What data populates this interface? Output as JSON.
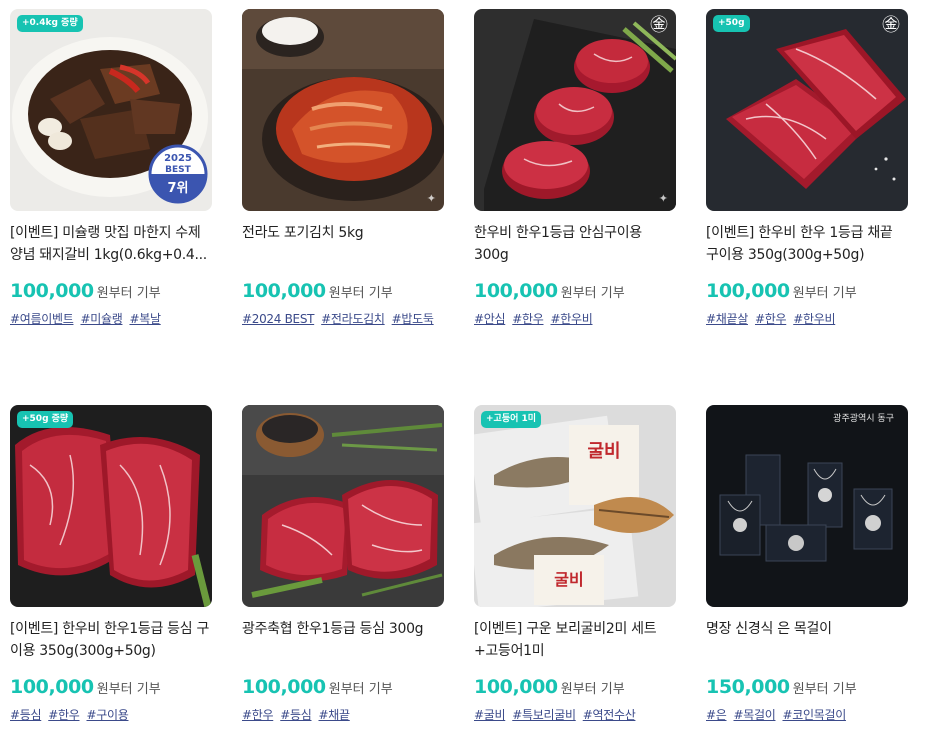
{
  "accent_color": "#17c3b2",
  "tag_color": "#3b4a8a",
  "products": [
    {
      "badge": "+0.4kg 증량",
      "image_overlay": [
        "2025",
        "BEST",
        "7위"
      ],
      "title": "[이벤트] 미슐랭 맛집 마한지 수제 양념 돼지갈비 1kg(0.6kg+0.4...",
      "price": "100,000",
      "price_suffix": "원부터 기부",
      "tags": [
        "#여름이벤트",
        "#미슐랭",
        "#복날"
      ]
    },
    {
      "badge": "",
      "title": "전라도 포기김치 5kg",
      "price": "100,000",
      "price_suffix": "원부터 기부",
      "tags": [
        "#2024 BEST",
        "#전라도김치",
        "#밥도둑"
      ]
    },
    {
      "badge": "",
      "title": "한우비 한우1등급 안심구이용 300g",
      "price": "100,000",
      "price_suffix": "원부터 기부",
      "tags": [
        "#안심",
        "#한우",
        "#한우비"
      ]
    },
    {
      "badge": "+50g",
      "title": "[이벤트] 한우비 한우 1등급 채끝 구이용 350g(300g+50g)",
      "price": "100,000",
      "price_suffix": "원부터 기부",
      "tags": [
        "#채끝살",
        "#한우",
        "#한우비"
      ]
    },
    {
      "badge": "+50g 증량",
      "title": "[이벤트] 한우비 한우1등급 등심 구이용 350g(300g+50g)",
      "price": "100,000",
      "price_suffix": "원부터 기부",
      "tags": [
        "#등심",
        "#한우",
        "#구이용"
      ]
    },
    {
      "badge": "",
      "title": "광주축협 한우1등급 등심 300g",
      "price": "100,000",
      "price_suffix": "원부터 기부",
      "tags": [
        "#한우",
        "#등심",
        "#채끝"
      ]
    },
    {
      "badge": "+고등어 1미",
      "title": "[이벤트] 구운 보리굴비2미 세트 +고등어1미",
      "price": "100,000",
      "price_suffix": "원부터 기부",
      "tags": [
        "#굴비",
        "#특보리굴비",
        "#역전수산"
      ]
    },
    {
      "badge": "",
      "image_overlay": [
        "광주광역시 동구"
      ],
      "title": "명장 신경식 은 목걸이",
      "price": "150,000",
      "price_suffix": "원부터 기부",
      "tags": [
        "#은",
        "#목걸이",
        "#코인목걸이"
      ]
    }
  ]
}
